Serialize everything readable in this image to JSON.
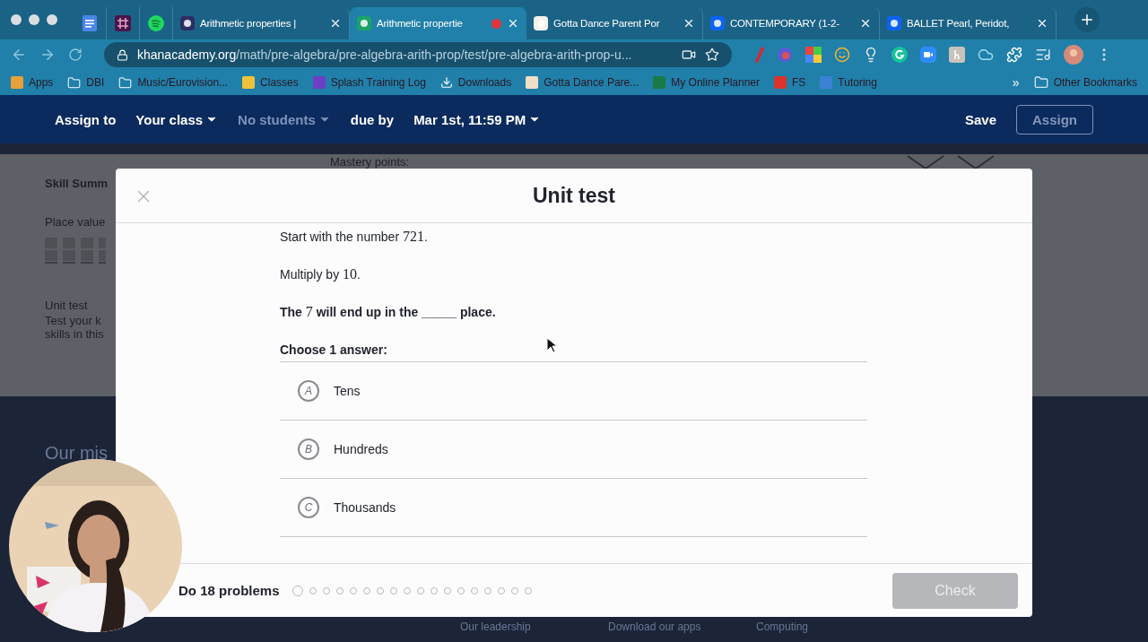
{
  "browser": {
    "tabs": [
      {
        "title": "Arithmetic properties |",
        "selected": false,
        "recording": false
      },
      {
        "title": "Arithmetic propertie",
        "selected": true,
        "recording": true
      },
      {
        "title": "Gotta Dance Parent Por",
        "selected": false,
        "recording": false
      },
      {
        "title": "CONTEMPORARY (1-2-",
        "selected": false,
        "recording": false
      },
      {
        "title": "BALLET Pearl, Peridot,",
        "selected": false,
        "recording": false
      }
    ],
    "url": {
      "host": "khanacademy.org",
      "path": "/math/pre-algebra/pre-algebra-arith-prop/test/pre-algebra-arith-prop-u..."
    },
    "bookmarks": [
      {
        "text": "Apps"
      },
      {
        "text": "DBI"
      },
      {
        "text": "Music/Eurovision..."
      },
      {
        "text": "Classes"
      },
      {
        "text": "Splash Training Log"
      },
      {
        "text": "Downloads"
      },
      {
        "text": "Gotta Dance Pare..."
      },
      {
        "text": "My Online Planner"
      },
      {
        "text": "FS"
      },
      {
        "text": "Tutoring"
      }
    ],
    "more_bookmarks": "»",
    "other_bookmarks": "Other Bookmarks"
  },
  "header": {
    "assign_label": "Assign to",
    "selects": [
      {
        "kind": "select",
        "text": "Your class",
        "disabled": false
      },
      {
        "kind": "select",
        "text": "No students",
        "disabled": true
      },
      {
        "kind": "label",
        "text": "due by",
        "disabled": false
      },
      {
        "kind": "select",
        "text": "Mar 1st, 11:59 PM",
        "disabled": false
      }
    ],
    "save": "Save",
    "assign": {
      "text": "Assign",
      "disabled": true
    }
  },
  "background_page": {
    "skill_summary": "Skill Summ",
    "mastery": "Mastery points:",
    "place_value": "Place value",
    "unit_test": "Unit test",
    "unit_test_desc": [
      "Test your k",
      "skills in this"
    ],
    "mission": "Our mis",
    "footer_links": [
      "Our leadership",
      "Download our apps",
      "Computing"
    ]
  },
  "modal": {
    "title": "Unit test",
    "question": [
      {
        "bold": false,
        "parts": [
          {
            "kind": "text",
            "text": "Start with the number "
          },
          {
            "kind": "math",
            "text": "721"
          },
          {
            "kind": "text",
            "text": "."
          }
        ]
      },
      {
        "bold": false,
        "parts": [
          {
            "kind": "text",
            "text": "Multiply by "
          },
          {
            "kind": "math",
            "text": "10"
          },
          {
            "kind": "text",
            "text": "."
          }
        ]
      },
      {
        "bold": true,
        "parts": [
          {
            "kind": "text",
            "text": "The "
          },
          {
            "kind": "math",
            "text": "7"
          },
          {
            "kind": "text",
            "text": " will end up in the _____ place."
          }
        ]
      },
      {
        "bold": true,
        "parts": [
          {
            "kind": "text",
            "text": "Choose 1 answer:"
          }
        ]
      }
    ],
    "choices": [
      {
        "letter": "A",
        "text": "Tens",
        "selected": false
      },
      {
        "letter": "B",
        "text": "Hundreds",
        "selected": false
      },
      {
        "letter": "C",
        "text": "Thousands",
        "selected": false
      }
    ],
    "footer": {
      "task": "Do 18 problems",
      "progress": [
        {
          "current": true
        },
        {
          "current": false
        },
        {
          "current": false
        },
        {
          "current": false
        },
        {
          "current": false
        },
        {
          "current": false
        },
        {
          "current": false
        },
        {
          "current": false
        },
        {
          "current": false
        },
        {
          "current": false
        },
        {
          "current": false
        },
        {
          "current": false
        },
        {
          "current": false
        },
        {
          "current": false
        },
        {
          "current": false
        },
        {
          "current": false
        },
        {
          "current": false
        },
        {
          "current": false
        }
      ],
      "check": {
        "text": "Check",
        "disabled": true
      }
    }
  }
}
